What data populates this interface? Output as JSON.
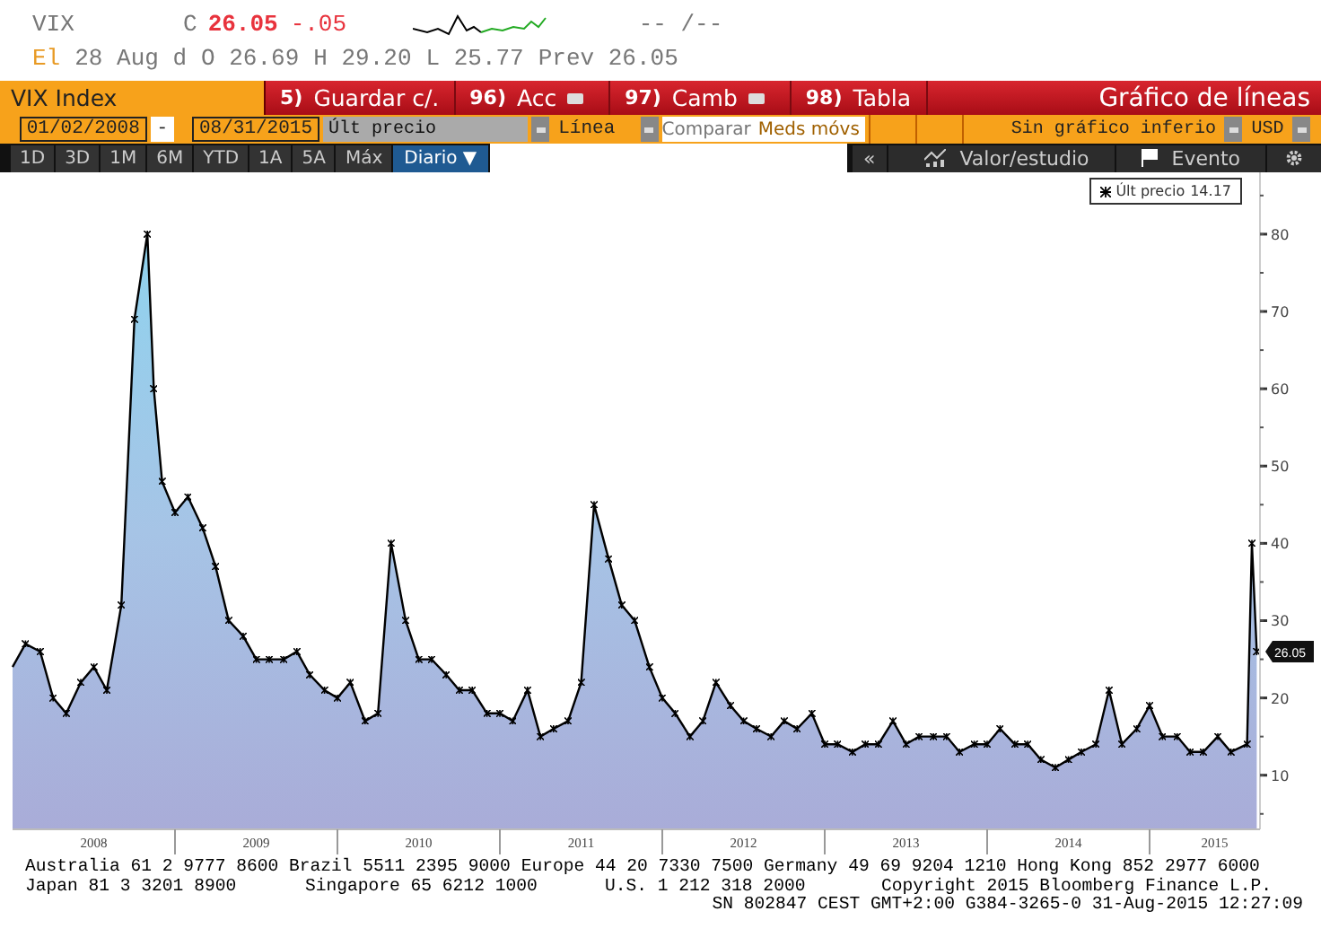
{
  "quote": {
    "ticker": "VIX",
    "change_label": "C",
    "last": "26.05",
    "change": "-.05",
    "bid_ask": "-- /--"
  },
  "quote_line": [
    {
      "kind": "source",
      "text": "El"
    },
    {
      "kind": "plain",
      "text": "28 Aug d"
    },
    {
      "kind": "plain",
      "text": "O 26.69"
    },
    {
      "kind": "plain",
      "text": "H 29.20"
    },
    {
      "kind": "plain",
      "text": "L 25.77"
    },
    {
      "kind": "plain",
      "text": "Prev 26.05"
    }
  ],
  "toolbar": {
    "security": "VIX Index",
    "buttons": [
      {
        "num": "5)",
        "label": "Guardar c/.",
        "dropdown": false
      },
      {
        "num": "96)",
        "label": "Acc",
        "dropdown": true
      },
      {
        "num": "97)",
        "label": "Camb",
        "dropdown": true
      },
      {
        "num": "98)",
        "label": "Tabla",
        "dropdown": false
      }
    ],
    "chart_type": "Gráfico de líneas"
  },
  "settings": {
    "start_date": "01/02/2008",
    "separator": "-",
    "end_date": "08/31/2015",
    "field": "Últ precio",
    "style": "Línea",
    "compare": "Comparar",
    "moving_averages": "Meds móvs",
    "lower_chart": "Sin gráfico inferio",
    "currency": "USD"
  },
  "periods": [
    {
      "label": "1D",
      "selected": false
    },
    {
      "label": "3D",
      "selected": false
    },
    {
      "label": "1M",
      "selected": false
    },
    {
      "label": "6M",
      "selected": false
    },
    {
      "label": "YTD",
      "selected": false
    },
    {
      "label": "1A",
      "selected": false
    },
    {
      "label": "5A",
      "selected": false
    },
    {
      "label": "Máx",
      "selected": false
    }
  ],
  "frequency": "Diario ▼",
  "chart_tools": [
    {
      "kind": "collapse",
      "label": "«"
    },
    {
      "kind": "study",
      "label": "Valor/estudio"
    },
    {
      "kind": "event",
      "label": "Evento"
    },
    {
      "kind": "settings"
    }
  ],
  "chart": {
    "legend_value": "14.17",
    "last_tag": "26.05",
    "chart_data": {
      "type": "area",
      "x": [
        2008.0,
        2008.08,
        2008.17,
        2008.25,
        2008.33,
        2008.42,
        2008.5,
        2008.58,
        2008.67,
        2008.75,
        2008.83,
        2008.87,
        2008.92,
        2009.0,
        2009.08,
        2009.17,
        2009.25,
        2009.33,
        2009.42,
        2009.5,
        2009.58,
        2009.67,
        2009.75,
        2009.83,
        2009.92,
        2010.0,
        2010.08,
        2010.17,
        2010.25,
        2010.33,
        2010.42,
        2010.5,
        2010.58,
        2010.67,
        2010.75,
        2010.83,
        2010.92,
        2011.0,
        2011.08,
        2011.17,
        2011.25,
        2011.33,
        2011.42,
        2011.5,
        2011.58,
        2011.67,
        2011.75,
        2011.83,
        2011.92,
        2012.0,
        2012.08,
        2012.17,
        2012.25,
        2012.33,
        2012.42,
        2012.5,
        2012.58,
        2012.67,
        2012.75,
        2012.83,
        2012.92,
        2013.0,
        2013.08,
        2013.17,
        2013.25,
        2013.33,
        2013.42,
        2013.5,
        2013.58,
        2013.67,
        2013.75,
        2013.83,
        2013.92,
        2014.0,
        2014.08,
        2014.17,
        2014.25,
        2014.33,
        2014.42,
        2014.5,
        2014.58,
        2014.67,
        2014.75,
        2014.83,
        2014.92,
        2015.0,
        2015.08,
        2015.17,
        2015.25,
        2015.33,
        2015.42,
        2015.5,
        2015.6,
        2015.63,
        2015.66
      ],
      "series": [
        {
          "name": "Últ precio",
          "color": "#000000",
          "values": [
            24,
            27,
            26,
            20,
            18,
            22,
            24,
            21,
            32,
            69,
            80,
            60,
            48,
            44,
            46,
            42,
            37,
            30,
            28,
            25,
            25,
            25,
            26,
            23,
            21,
            20,
            22,
            17,
            18,
            40,
            30,
            25,
            25,
            23,
            21,
            21,
            18,
            18,
            17,
            21,
            15,
            16,
            17,
            22,
            45,
            38,
            32,
            30,
            24,
            20,
            18,
            15,
            17,
            22,
            19,
            17,
            16,
            15,
            17,
            16,
            18,
            14,
            14,
            13,
            14,
            14,
            17,
            14,
            15,
            15,
            15,
            13,
            14,
            14,
            16,
            14,
            14,
            12,
            11,
            12,
            13,
            14,
            21,
            14,
            16,
            19,
            15,
            15,
            13,
            13,
            15,
            13,
            14,
            40,
            26
          ]
        }
      ],
      "xlim": [
        2008,
        2015.68
      ],
      "ylim": [
        3,
        88
      ],
      "xticks": [
        {
          "value": 2008.5,
          "label": "2008"
        },
        {
          "value": 2009.5,
          "label": "2009"
        },
        {
          "value": 2010.5,
          "label": "2010"
        },
        {
          "value": 2011.5,
          "label": "2011"
        },
        {
          "value": 2012.5,
          "label": "2012"
        },
        {
          "value": 2013.5,
          "label": "2013"
        },
        {
          "value": 2014.5,
          "label": "2014"
        },
        {
          "value": 2015.4,
          "label": "2015"
        }
      ],
      "yticks": [
        10,
        20,
        30,
        40,
        50,
        60,
        70,
        80
      ]
    }
  },
  "footer": {
    "line_1": "Australia 61 2 9777 8600 Brazil 5511 2395 9000 Europe 44 20 7330 7500 Germany 49 69 9204 1210 Hong Kong 852 2977 6000",
    "line_2": [
      "Japan 81 3 3201 8900",
      "Singapore 65 6212 1000",
      "U.S. 1 212 318 2000",
      "Copyright 2015 Bloomberg Finance L.P."
    ],
    "line_3": "SN 802847 CEST GMT+2:00 G384-3265-0 31-Aug-2015 12:27:09"
  }
}
